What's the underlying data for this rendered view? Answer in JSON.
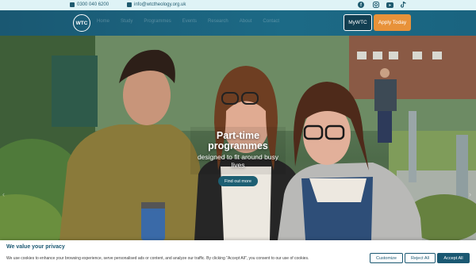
{
  "topbar": {
    "phone": "0300 040 6200",
    "email": "info@wtctheology.org.uk",
    "social_icons": [
      "facebook-icon",
      "instagram-icon",
      "youtube-icon",
      "tiktok-icon"
    ]
  },
  "header": {
    "logo_text": "WTC",
    "nav_items": [
      "Home",
      "Study",
      "Programmes",
      "Events",
      "Research",
      "About",
      "Contact"
    ],
    "mywtc_label": "MyWTC",
    "apply_label": "Apply Today"
  },
  "hero": {
    "title": "Part-time programmes",
    "subtitle": "designed to fit around busy lives",
    "cta_label": "Find out more"
  },
  "cookie": {
    "title": "We value your privacy",
    "text": "We use cookies to enhance your browsing experience, serve personalised ads or content, and analyze our traffic. By clicking \"Accept All\", you consent to our use of cookies.",
    "customize_label": "Customize",
    "reject_label": "Reject All",
    "accept_label": "Accept All"
  },
  "colors": {
    "brand": "#1a5872",
    "accent": "#e8923a",
    "topbar_bg": "#dff3f6"
  }
}
